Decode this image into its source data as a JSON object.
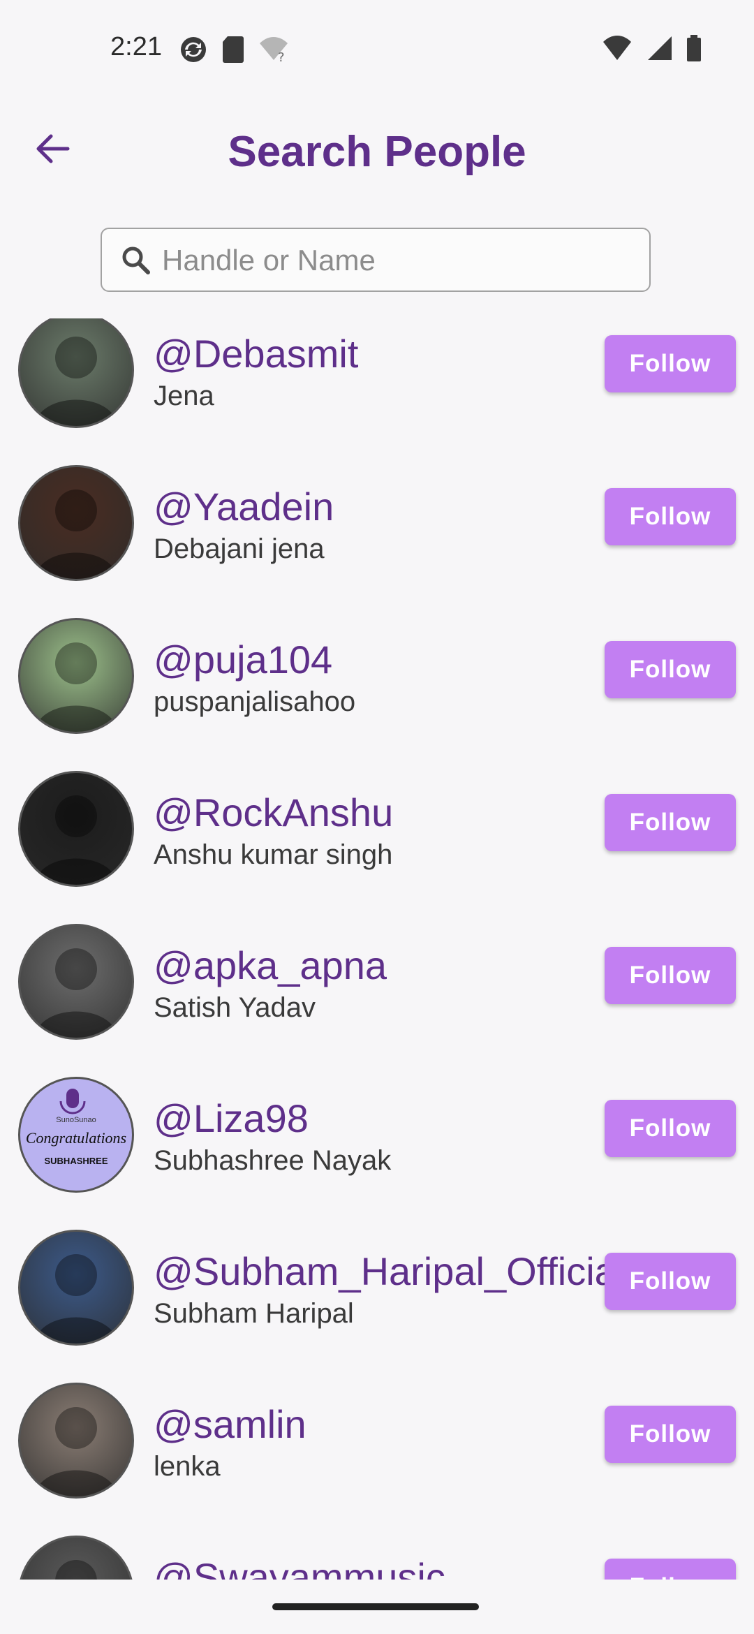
{
  "status_bar": {
    "time": "2:21"
  },
  "header": {
    "title": "Search People"
  },
  "search": {
    "placeholder": "Handle or Name",
    "value": ""
  },
  "users": [
    {
      "handle": "@Debasmit",
      "name": "Jena",
      "follow_label": "Follow",
      "avatar_color": "#6b7b6a"
    },
    {
      "handle": "@Yaadein",
      "name": "Debajani jena",
      "follow_label": "Follow",
      "avatar_color": "#4a2d22"
    },
    {
      "handle": "@puja104",
      "name": "puspanjalisahoo",
      "follow_label": "Follow",
      "avatar_color": "#9bbf8a"
    },
    {
      "handle": "@RockAnshu",
      "name": "Anshu kumar singh",
      "follow_label": "Follow",
      "avatar_color": "#1c1c1c"
    },
    {
      "handle": "@apka_apna",
      "name": "Satish Yadav",
      "follow_label": "Follow",
      "avatar_color": "#6d6d6d"
    },
    {
      "handle": "@Liza98",
      "name": "Subhashree Nayak",
      "follow_label": "Follow",
      "avatar_color": "#b9b2f0",
      "avatar_text": {
        "brand": "SunoSunao",
        "headline": "Congratulations",
        "caption": "SUBHASHREE"
      }
    },
    {
      "handle": "@Subham_Haripal_Official",
      "name": "Subham Haripal",
      "follow_label": "Follow",
      "avatar_color": "#3c5a8a"
    },
    {
      "handle": "@samlin",
      "name": "lenka",
      "follow_label": "Follow",
      "avatar_color": "#8a7d74"
    },
    {
      "handle": "@Swayammusic",
      "name": "",
      "follow_label": "Follow",
      "avatar_color": "#5a5a5a"
    }
  ],
  "colors": {
    "accent": "#5e2f8a",
    "button": "#c27ff2",
    "background": "#f7f6f8"
  }
}
